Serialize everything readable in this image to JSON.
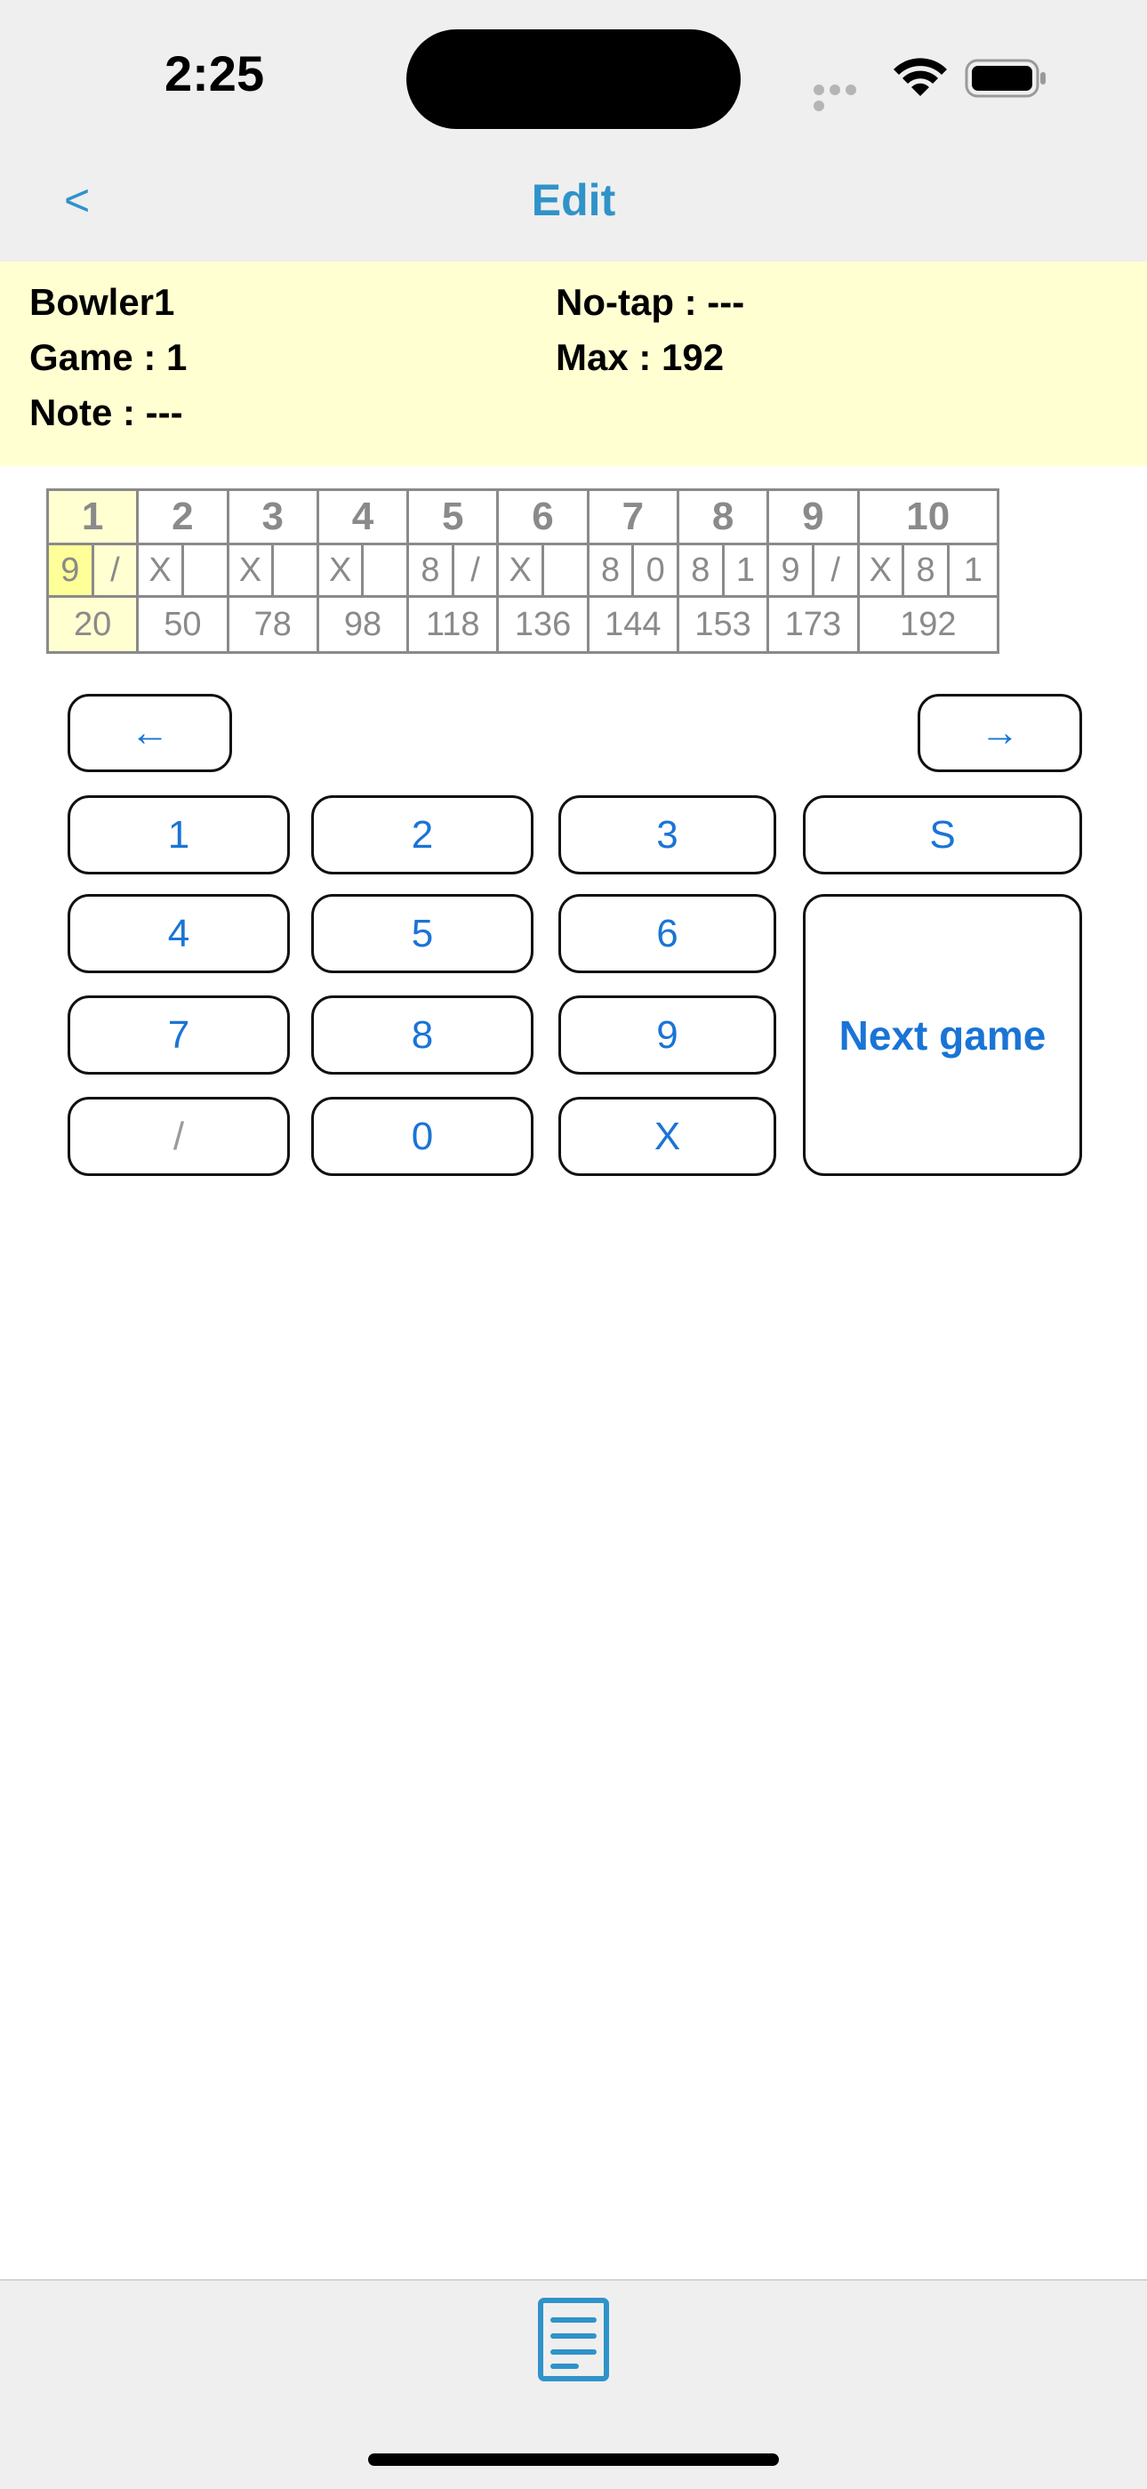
{
  "status": {
    "time": "2:25"
  },
  "nav": {
    "back": "<",
    "title": "Edit"
  },
  "info": {
    "bowler": "Bowler1",
    "game": "Game : 1",
    "note": "Note : ---",
    "notap": "No-tap : ---",
    "max": "Max : 192"
  },
  "score": {
    "frames": [
      "1",
      "2",
      "3",
      "4",
      "5",
      "6",
      "7",
      "8",
      "9",
      "10"
    ],
    "rolls": [
      "9",
      "/",
      "X",
      "",
      "X",
      "",
      "X",
      "",
      "8",
      "/",
      "X",
      "",
      "8",
      "0",
      "8",
      "1",
      "9",
      "/",
      "X",
      "8",
      "1"
    ],
    "totals": [
      "20",
      "50",
      "78",
      "98",
      "118",
      "136",
      "144",
      "153",
      "173",
      "192"
    ]
  },
  "keypad": {
    "prev": "←",
    "next": "→",
    "k1": "1",
    "k2": "2",
    "k3": "3",
    "ks": "S",
    "k4": "4",
    "k5": "5",
    "k6": "6",
    "k7": "7",
    "k8": "8",
    "k9": "9",
    "kslash": "/",
    "k0": "0",
    "kx": "X",
    "next_game": "Next game"
  },
  "colors": {
    "accent": "#2f93c9",
    "button_text": "#1a74d6",
    "info_bg": "#ffffd2"
  },
  "icons": {
    "tab": "document-lines-icon"
  }
}
